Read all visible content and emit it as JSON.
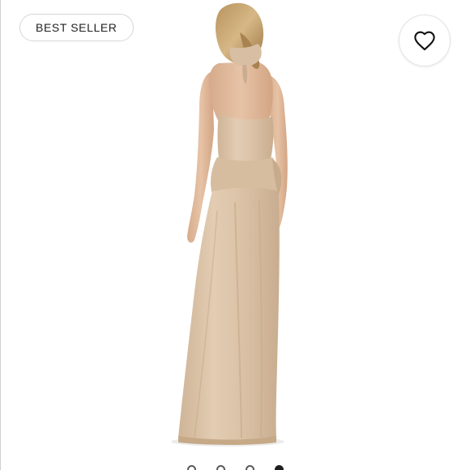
{
  "badge": {
    "label": "BEST SELLER"
  },
  "like_button": {
    "icon": "heart-icon"
  },
  "photo": {
    "subject": "",
    "dress_color": "#dcc3a8",
    "background": "#ffffff"
  },
  "carousel": {
    "count": 4,
    "active_index": 3
  }
}
